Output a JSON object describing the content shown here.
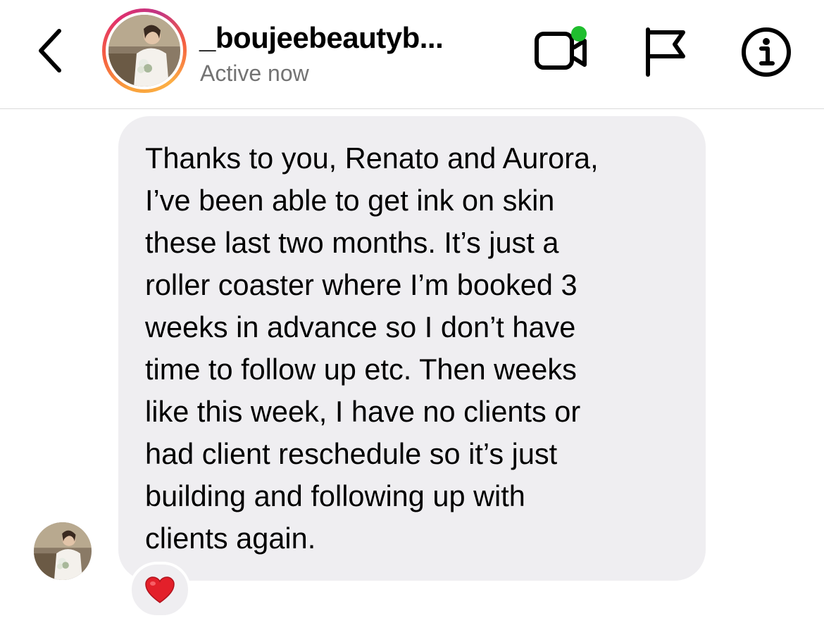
{
  "header": {
    "username": "_boujeebeautyb...",
    "status": "Active now",
    "icons": {
      "back": "chevron-left-icon",
      "video": "video-call-icon",
      "flag": "flag-icon",
      "info": "info-icon"
    },
    "online_indicator_color": "#1fbe2e",
    "story_ring_colors": [
      "#f9a23c",
      "#f56040",
      "#e1306c",
      "#c13584"
    ]
  },
  "message": {
    "lines": [
      "Thanks to you, Renato and Aurora,",
      "I’ve been able to get ink on skin",
      "these last two months. It’s just a",
      "roller coaster where I’m booked 3",
      "weeks in advance so I don’t have",
      "time to follow up etc. Then weeks",
      "like this week, I have no clients or",
      "had client reschedule so it’s just",
      "building and following up with",
      "clients again."
    ],
    "bubble_color": "#efeef1",
    "reaction": "❤️",
    "reaction_icon": "heart-icon"
  }
}
